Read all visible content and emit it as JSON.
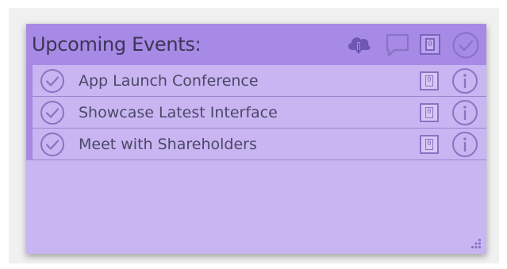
{
  "widget": {
    "title": "Upcoming Events:",
    "header_icons": [
      "cloud-download-icon",
      "comment-icon",
      "counter-icon",
      "check-circle-icon"
    ],
    "counter_label": "0"
  },
  "events": [
    {
      "label": "App Launch Conference",
      "count": "0"
    },
    {
      "label": "Showcase Latest Interface",
      "count": "0"
    },
    {
      "label": "Meet with Shareholders",
      "count": "0"
    }
  ],
  "colors": {
    "header": "#a78ae6",
    "body": "#c9b5f1",
    "icon": "#8a73c3",
    "text": "#4b4868"
  }
}
